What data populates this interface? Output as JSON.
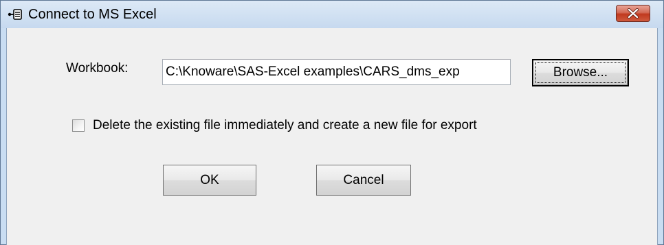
{
  "window": {
    "title": "Connect to MS Excel",
    "icon": "excel-connection-icon",
    "close_icon": "close-icon"
  },
  "form": {
    "workbook_label": "Workbook:",
    "workbook_value": "C:\\Knoware\\SAS-Excel examples\\CARS_dms_exp",
    "browse_label": "Browse...",
    "delete_checkbox_checked": false,
    "delete_checkbox_label": "Delete the existing file immediately and create a new file for export"
  },
  "buttons": {
    "ok_label": "OK",
    "cancel_label": "Cancel"
  },
  "colors": {
    "titlebar": "#c6d9ef",
    "client": "#f0f0f0",
    "close_button": "#c0391f"
  }
}
